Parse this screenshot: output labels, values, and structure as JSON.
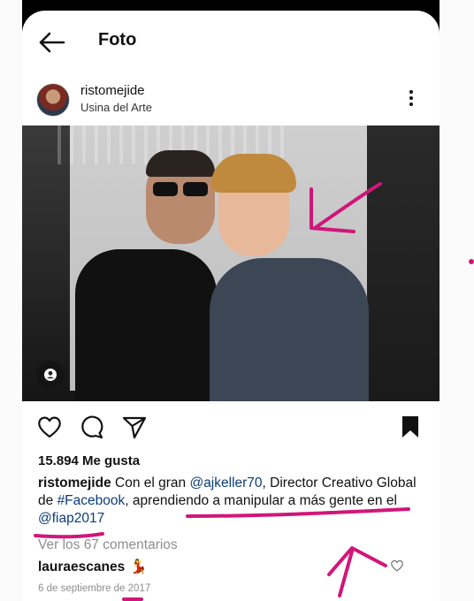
{
  "header": {
    "title": "Foto"
  },
  "post": {
    "username": "ristomejide",
    "location": "Usina del Arte",
    "likes": "15.894 Me gusta",
    "caption": {
      "username": "ristomejide",
      "text_1": " Con el gran ",
      "mention_1": "@ajkeller70",
      "text_2": ", Director Creativo Global de ",
      "hashtag": "#Facebook",
      "text_3": ", aprendiendo a manipular a más gente en el ",
      "mention_2": "@fiap2017"
    },
    "view_comments": "Ver los 67 comentarios",
    "comment": {
      "username": "lauraescanes",
      "emoji": "💃"
    },
    "date": "6 de septiembre de 2017"
  },
  "icons": [
    "back-arrow-icon",
    "more-options-icon",
    "user-tag-icon",
    "heart-icon",
    "comment-icon",
    "share-icon",
    "bookmark-icon"
  ],
  "colors": {
    "annotation": "#d0167a",
    "link": "#0c3c78",
    "muted": "#8e8e8e"
  }
}
